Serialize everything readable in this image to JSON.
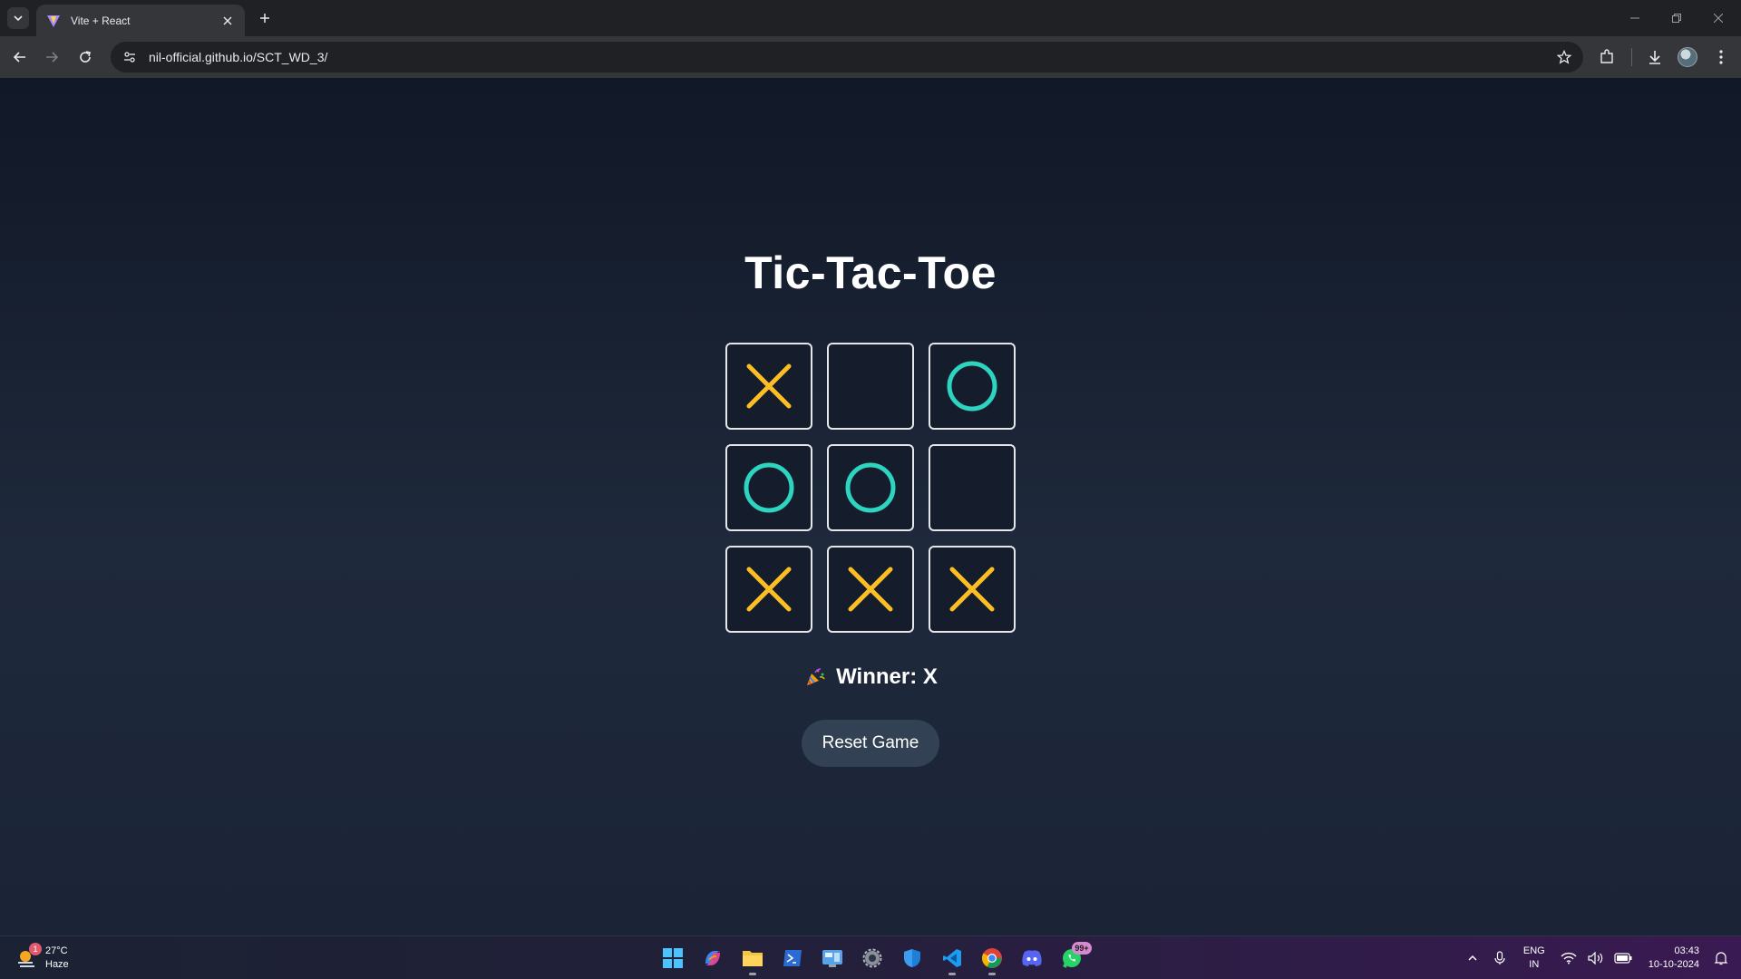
{
  "browser": {
    "tab_title": "Vite + React",
    "url": "nil-official.github.io/SCT_WD_3/"
  },
  "game": {
    "title": "Tic-Tac-Toe",
    "board": [
      "X",
      "",
      "O",
      "O",
      "O",
      "",
      "X",
      "X",
      "X"
    ],
    "status": "Winner: X",
    "reset_label": "Reset Game",
    "colors": {
      "x": "#fbbf24",
      "o": "#2dd4bf"
    }
  },
  "taskbar": {
    "weather_temp": "27°C",
    "weather_desc": "Haze",
    "weather_badge": "1",
    "whatsapp_badge": "99+",
    "lang_top": "ENG",
    "lang_bottom": "IN",
    "time": "03:43",
    "date": "10-10-2024"
  }
}
